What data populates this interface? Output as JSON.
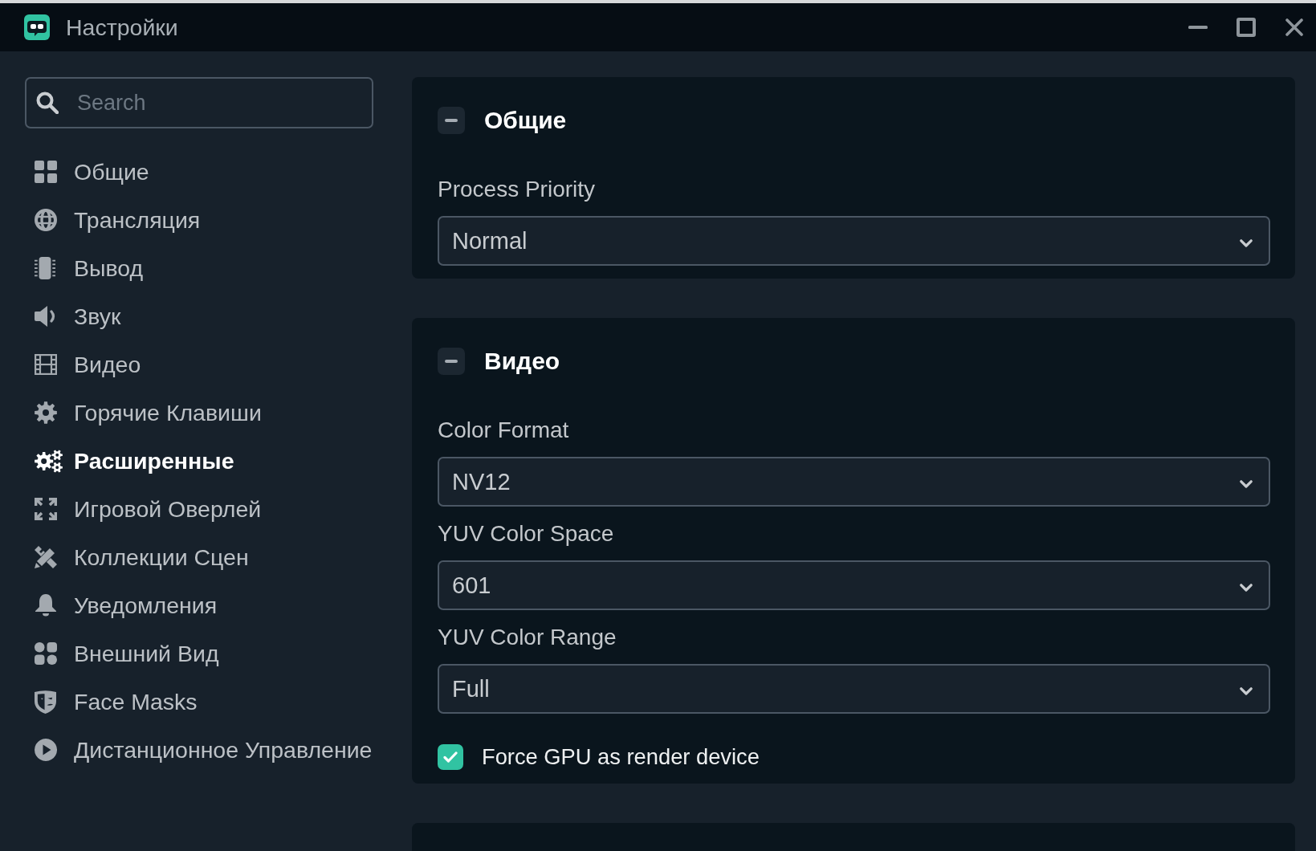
{
  "window": {
    "title": "Настройки"
  },
  "sidebar": {
    "search": {
      "placeholder": "Search"
    },
    "items": [
      {
        "label": "Общие",
        "selected": false
      },
      {
        "label": "Трансляция",
        "selected": false
      },
      {
        "label": "Вывод",
        "selected": false
      },
      {
        "label": "Звук",
        "selected": false
      },
      {
        "label": "Видео",
        "selected": false
      },
      {
        "label": "Горячие Клавиши",
        "selected": false
      },
      {
        "label": "Расширенные",
        "selected": true
      },
      {
        "label": "Игровой Оверлей",
        "selected": false
      },
      {
        "label": "Коллекции Сцен",
        "selected": false
      },
      {
        "label": "Уведомления",
        "selected": false
      },
      {
        "label": "Внешний Вид",
        "selected": false
      },
      {
        "label": "Face Masks",
        "selected": false
      },
      {
        "label": "Дистанционное Управление",
        "selected": false
      }
    ]
  },
  "sections": [
    {
      "title": "Общие",
      "expanded": true,
      "fields": [
        {
          "kind": "select",
          "label": "Process Priority",
          "value": "Normal"
        }
      ]
    },
    {
      "title": "Видео",
      "expanded": true,
      "fields": [
        {
          "kind": "select",
          "label": "Color Format",
          "value": "NV12"
        },
        {
          "kind": "select",
          "label": "YUV Color Space",
          "value": "601"
        },
        {
          "kind": "select",
          "label": "YUV Color Range",
          "value": "Full"
        },
        {
          "kind": "checkbox",
          "label": "Force GPU as render device",
          "checked": true
        }
      ]
    }
  ]
}
